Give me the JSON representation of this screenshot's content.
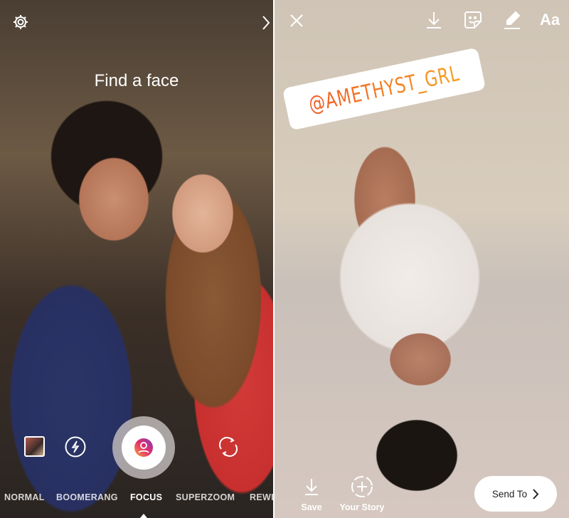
{
  "camera": {
    "prompt": "Find a face",
    "modes": [
      {
        "label": "NORMAL",
        "active": false
      },
      {
        "label": "BOOMERANG",
        "active": false
      },
      {
        "label": "FOCUS",
        "active": true
      },
      {
        "label": "SUPERZOOM",
        "active": false
      },
      {
        "label": "REWI",
        "active": false
      }
    ],
    "icons": [
      "gear-icon",
      "chevron-right-icon",
      "gallery-thumbnail",
      "flash-icon",
      "focus-shutter-icon",
      "flip-camera-icon"
    ]
  },
  "editor": {
    "mention_sticker": "@AMETHYST_GRL",
    "mention_gradient": [
      "#f05a24",
      "#f7a024"
    ],
    "text_tool": "Aa",
    "save_label": "Save",
    "your_story_label": "Your Story",
    "send_to_label": "Send To",
    "icons": [
      "close-icon",
      "download-icon",
      "sticker-icon",
      "draw-icon",
      "text-icon"
    ]
  }
}
